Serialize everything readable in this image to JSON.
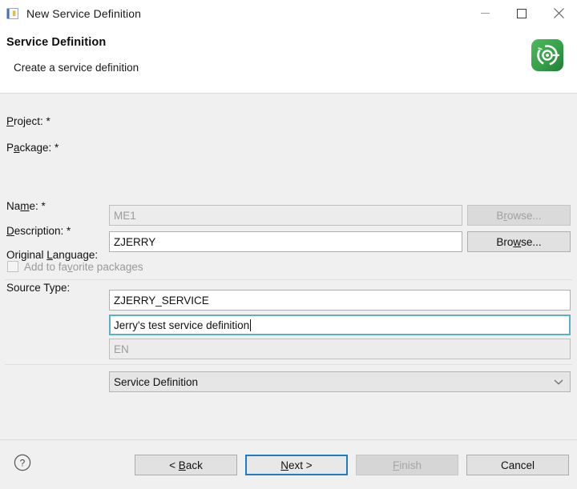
{
  "window": {
    "title": "New Service Definition",
    "icon": "service-definition-file-icon",
    "controls": {
      "minimize": "minimize-icon",
      "maximize": "maximize-icon",
      "close": "close-icon"
    }
  },
  "header": {
    "title": "Service Definition",
    "subtitle": "Create a service definition",
    "icon": "sap-service-definition-badge-icon",
    "icon_color": "#37a04a"
  },
  "form": {
    "project": {
      "label_pre": "",
      "label_mnemonic": "P",
      "label_post": "roject: *",
      "value": "ME1",
      "readonly": true,
      "browse": {
        "pre": "B",
        "mnemonic": "r",
        "post": "owse...",
        "disabled": true
      }
    },
    "package": {
      "label_pre": "P",
      "label_mnemonic": "a",
      "label_post": "ckage: *",
      "value": "ZJERRY",
      "readonly": false,
      "browse": {
        "pre": "Bro",
        "mnemonic": "w",
        "post": "se...",
        "disabled": false
      }
    },
    "favorite": {
      "pre": "Add to fa",
      "mnemonic": "v",
      "post": "orite packages",
      "checked": false,
      "disabled": true
    },
    "name": {
      "label_pre": "Na",
      "label_mnemonic": "m",
      "label_post": "e: *",
      "value": "ZJERRY_SERVICE"
    },
    "description": {
      "label_pre": "",
      "label_mnemonic": "D",
      "label_post": "escription: *",
      "value": "Jerry's test service definition",
      "focused": true
    },
    "original_language": {
      "label_pre": "Original ",
      "label_mnemonic": "L",
      "label_post": "anguage:",
      "value": "EN",
      "readonly": true
    },
    "source_type": {
      "label": "Source Type:",
      "value": "Service Definition",
      "options": [
        "Service Definition"
      ],
      "chevron": "chevron-down-icon"
    }
  },
  "footer": {
    "help": "help-icon",
    "back": {
      "pre": "< ",
      "mnemonic": "B",
      "post": "ack",
      "disabled": false,
      "default": false
    },
    "next": {
      "pre": "",
      "mnemonic": "N",
      "post": "ext >",
      "disabled": false,
      "default": true
    },
    "finish": {
      "pre": "",
      "mnemonic": "F",
      "post": "inish",
      "disabled": true,
      "default": false
    },
    "cancel": {
      "pre": "Cancel",
      "mnemonic": "",
      "post": "",
      "disabled": false,
      "default": false
    }
  },
  "colors": {
    "focus_border": "#5ab0c4",
    "default_button_border": "#1d7dc4",
    "accent_green": "#37a04a"
  }
}
